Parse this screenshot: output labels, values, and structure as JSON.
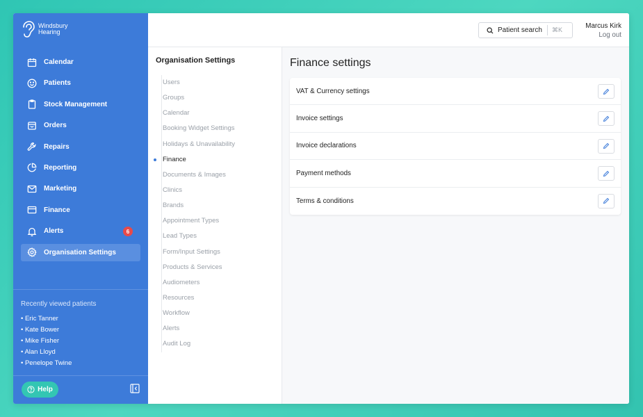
{
  "brand": {
    "line1": "Windsbury",
    "line2": "Hearing"
  },
  "nav": [
    {
      "label": "Calendar",
      "icon": "calendar-icon"
    },
    {
      "label": "Patients",
      "icon": "smile-icon"
    },
    {
      "label": "Stock Management",
      "icon": "clipboard-icon"
    },
    {
      "label": "Orders",
      "icon": "box-icon"
    },
    {
      "label": "Repairs",
      "icon": "wrench-icon"
    },
    {
      "label": "Reporting",
      "icon": "pie-chart-icon"
    },
    {
      "label": "Marketing",
      "icon": "mail-icon"
    },
    {
      "label": "Finance",
      "icon": "card-icon"
    },
    {
      "label": "Alerts",
      "icon": "bell-icon",
      "badge": "6"
    },
    {
      "label": "Organisation Settings",
      "icon": "gear-icon",
      "active": true
    }
  ],
  "recent": {
    "title": "Recently viewed patients",
    "patients": [
      "• Eric Tanner",
      "• Kate Bower",
      "• Mike Fisher",
      "• Alan Lloyd",
      "• Penelope Twine"
    ]
  },
  "help_label": "Help",
  "search": {
    "label": "Patient search",
    "shortcut": "⌘K"
  },
  "user": {
    "name": "Marcus Kirk",
    "logout": "Log out"
  },
  "subnav": {
    "title": "Organisation Settings",
    "items": [
      "Users",
      "Groups",
      "Calendar",
      "Booking Widget Settings",
      "Holidays & Unavailability",
      "Finance",
      "Documents & Images",
      "Clinics",
      "Brands",
      "Appointment Types",
      "Lead Types",
      "Form/Input Settings",
      "Products & Services",
      "Audiometers",
      "Resources",
      "Workflow",
      "Alerts",
      "Audit Log"
    ],
    "active": "Finance"
  },
  "page": {
    "title": "Finance settings",
    "rows": [
      "VAT & Currency settings",
      "Invoice settings",
      "Invoice declarations",
      "Payment methods",
      "Terms & conditions"
    ]
  },
  "colors": {
    "sidebar": "#3d7bd9",
    "accent": "#33c6b3",
    "badge": "#e84a4a"
  }
}
